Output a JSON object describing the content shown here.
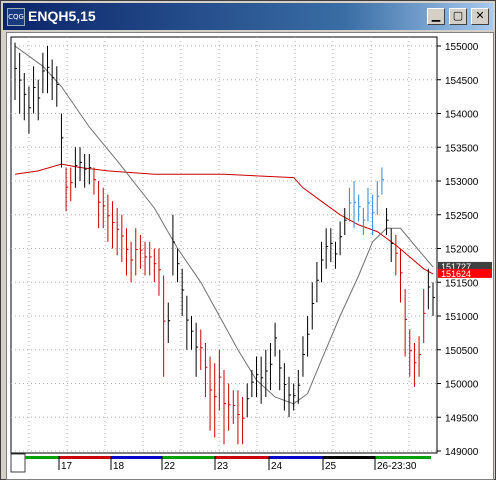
{
  "window": {
    "title": "ENQH5,15",
    "icon": "cqg-app-icon",
    "controls": [
      "minimize-icon",
      "maximize-icon",
      "close-icon"
    ]
  },
  "chart_data": {
    "type": "bar",
    "y_ticks": [
      "155000",
      "154500",
      "154000",
      "153500",
      "153000",
      "152500",
      "152000",
      "151500",
      "151000",
      "150500",
      "150000",
      "149500",
      "149000"
    ],
    "ylim": [
      148950,
      155200
    ],
    "x_labels": [
      "17",
      "18",
      "22",
      "23",
      "24",
      "25",
      "26-23:30"
    ],
    "price_labels": [
      {
        "text": "151727",
        "value": 151727,
        "color": "#404040"
      },
      {
        "text": "151624",
        "value": 151624,
        "color": "#ff0000"
      }
    ],
    "colors": {
      "up": "#000000",
      "down": "#cc0000",
      "strong": "#2e86d6",
      "ma_slow": "#cc0000",
      "ma_fast": "#707070"
    },
    "bars": [
      [
        155050,
        154200,
        "k"
      ],
      [
        154900,
        154000,
        "k"
      ],
      [
        154600,
        153900,
        "k"
      ],
      [
        154400,
        153700,
        "k"
      ],
      [
        154700,
        154000,
        "k"
      ],
      [
        154500,
        153900,
        "k"
      ],
      [
        154900,
        154300,
        "k"
      ],
      [
        155000,
        154300,
        "k"
      ],
      [
        154800,
        154200,
        "k"
      ],
      [
        154700,
        154100,
        "k"
      ],
      [
        154000,
        153200,
        "k"
      ],
      [
        153200,
        152550,
        "r"
      ],
      [
        153200,
        152700,
        "r"
      ],
      [
        153500,
        152900,
        "k"
      ],
      [
        153500,
        153000,
        "k"
      ],
      [
        153400,
        152900,
        "k"
      ],
      [
        153400,
        152950,
        "k"
      ],
      [
        153200,
        152800,
        "r"
      ],
      [
        153000,
        152300,
        "r"
      ],
      [
        152900,
        152300,
        "r"
      ],
      [
        152800,
        152100,
        "r"
      ],
      [
        152700,
        152000,
        "r"
      ],
      [
        152600,
        151900,
        "r"
      ],
      [
        152500,
        151800,
        "r"
      ],
      [
        152300,
        151600,
        "r"
      ],
      [
        152100,
        151500,
        "r"
      ],
      [
        152300,
        151600,
        "r"
      ],
      [
        152200,
        151700,
        "r"
      ],
      [
        152100,
        151600,
        "r"
      ],
      [
        152100,
        151600,
        "r"
      ],
      [
        152000,
        151500,
        "r"
      ],
      [
        152000,
        151300,
        "r"
      ],
      [
        151600,
        150100,
        "r"
      ],
      [
        151200,
        150600,
        "k"
      ],
      [
        152500,
        151600,
        "k"
      ],
      [
        152000,
        151500,
        "k"
      ],
      [
        151700,
        151000,
        "k"
      ],
      [
        151300,
        150500,
        "k"
      ],
      [
        151000,
        150500,
        "k"
      ],
      [
        150900,
        150100,
        "k"
      ],
      [
        150800,
        150200,
        "r"
      ],
      [
        150600,
        149800,
        "r"
      ],
      [
        150400,
        149300,
        "r"
      ],
      [
        150300,
        149200,
        "r"
      ],
      [
        150500,
        149600,
        "r"
      ],
      [
        150200,
        149100,
        "r"
      ],
      [
        150000,
        149300,
        "r"
      ],
      [
        149900,
        149400,
        "r"
      ],
      [
        149900,
        149100,
        "r"
      ],
      [
        149800,
        149100,
        "r"
      ],
      [
        150000,
        149500,
        "k"
      ],
      [
        150200,
        149800,
        "k"
      ],
      [
        150400,
        149800,
        "k"
      ],
      [
        150400,
        149700,
        "k"
      ],
      [
        150500,
        149800,
        "k"
      ],
      [
        150600,
        149900,
        "k"
      ],
      [
        150900,
        150400,
        "k"
      ],
      [
        150500,
        149900,
        "k"
      ],
      [
        150300,
        149600,
        "k"
      ],
      [
        150100,
        149500,
        "k"
      ],
      [
        150000,
        149600,
        "k"
      ],
      [
        150200,
        149700,
        "k"
      ],
      [
        150700,
        150100,
        "k"
      ],
      [
        151000,
        150400,
        "k"
      ],
      [
        151500,
        150800,
        "k"
      ],
      [
        151800,
        151200,
        "k"
      ],
      [
        152100,
        151500,
        "k"
      ],
      [
        152300,
        151700,
        "k"
      ],
      [
        152300,
        151800,
        "k"
      ],
      [
        152100,
        151700,
        "k"
      ],
      [
        152400,
        151900,
        "k"
      ],
      [
        152600,
        152200,
        "k"
      ],
      [
        152900,
        152400,
        "b"
      ],
      [
        153000,
        152300,
        "b"
      ],
      [
        152800,
        152400,
        "b"
      ],
      [
        152600,
        152200,
        "b"
      ],
      [
        152900,
        152400,
        "b"
      ],
      [
        152800,
        152200,
        "b"
      ],
      [
        153000,
        152500,
        "b"
      ],
      [
        153200,
        152800,
        "b"
      ],
      [
        152600,
        152200,
        "k"
      ],
      [
        152300,
        151800,
        "k"
      ],
      [
        152200,
        151600,
        "r"
      ],
      [
        152000,
        151200,
        "r"
      ],
      [
        151400,
        150400,
        "r"
      ],
      [
        150800,
        150100,
        "r"
      ],
      [
        150600,
        149950,
        "r"
      ],
      [
        150700,
        150100,
        "r"
      ],
      [
        151400,
        150600,
        "r"
      ],
      [
        151700,
        151100,
        "k"
      ],
      [
        151500,
        151000,
        "k"
      ]
    ],
    "ma_slow": [
      [
        0,
        153100
      ],
      [
        5,
        153150
      ],
      [
        10,
        153250
      ],
      [
        14,
        153200
      ],
      [
        20,
        153150
      ],
      [
        30,
        153100
      ],
      [
        45,
        153100
      ],
      [
        60,
        153050
      ],
      [
        62,
        152900
      ],
      [
        66,
        152700
      ],
      [
        70,
        152500
      ],
      [
        74,
        152350
      ],
      [
        78,
        152250
      ],
      [
        82,
        152050
      ],
      [
        88,
        151700
      ],
      [
        90,
        151624
      ]
    ],
    "ma_fast": [
      [
        0,
        155000
      ],
      [
        6,
        154700
      ],
      [
        10,
        154400
      ],
      [
        16,
        153800
      ],
      [
        22,
        153300
      ],
      [
        30,
        152600
      ],
      [
        35,
        152000
      ],
      [
        40,
        151500
      ],
      [
        44,
        151000
      ],
      [
        48,
        150500
      ],
      [
        52,
        150050
      ],
      [
        56,
        149800
      ],
      [
        60,
        149700
      ],
      [
        63,
        149850
      ],
      [
        66,
        150350
      ],
      [
        70,
        151000
      ],
      [
        74,
        151600
      ],
      [
        77,
        152100
      ],
      [
        80,
        152300
      ],
      [
        83,
        152300
      ],
      [
        86,
        152050
      ],
      [
        90,
        151727
      ]
    ]
  }
}
